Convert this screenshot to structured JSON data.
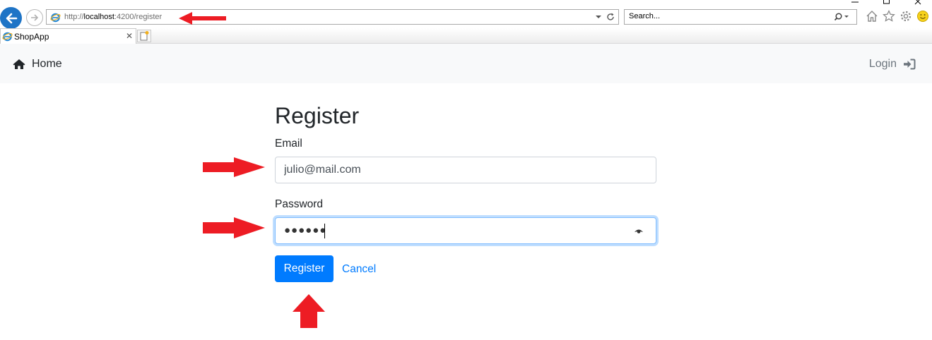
{
  "browser": {
    "address": {
      "scheme": "http://",
      "host": "localhost",
      "rest": ":4200/register"
    },
    "search": {
      "placeholder": "Search..."
    },
    "tab": {
      "title": "ShopApp"
    },
    "accent": "#1e74c6"
  },
  "navbar": {
    "home_label": "Home",
    "login_label": "Login",
    "icons": {
      "home": "home-icon",
      "login": "sign-in-icon"
    }
  },
  "form": {
    "title": "Register",
    "email_label": "Email",
    "email_value": "julio@mail.com",
    "password_label": "Password",
    "password_masked": "●●●●●●",
    "register_label": "Register",
    "cancel_label": "Cancel",
    "colors": {
      "primary": "#007bff",
      "focus_border": "#80bdff"
    }
  },
  "annotations": {
    "arrow_color": "#ed1c24"
  }
}
